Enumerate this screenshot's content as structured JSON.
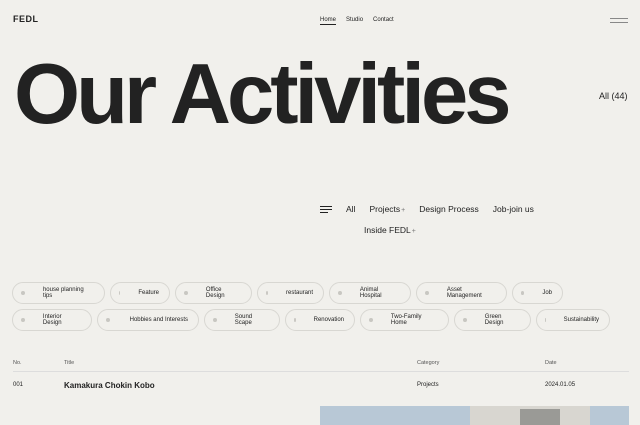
{
  "header": {
    "logo": "FEDL",
    "nav": [
      "Home",
      "Studio",
      "Contact"
    ]
  },
  "hero": {
    "title": "Our Activities",
    "total": "All (44)"
  },
  "filters": {
    "row1": [
      "All",
      "Projects",
      "Design Process",
      "Job-join us"
    ],
    "row2": [
      "Inside FEDL"
    ],
    "plus": "+"
  },
  "tags": {
    "row1": [
      "house planning tips",
      "Feature",
      "Office Design",
      "restaurant",
      "Animal Hospital",
      "Asset Management",
      "Job"
    ],
    "row2": [
      "Interior Design",
      "Hobbies and Interests",
      "Sound Scape",
      "Renovation",
      "Two-Family Home",
      "Green Design",
      "Sustainability"
    ]
  },
  "table": {
    "headers": {
      "no": "No.",
      "title": "Title",
      "category": "Category",
      "date": "Date"
    },
    "rows": [
      {
        "no": "001",
        "title": "Kamakura Chokin Kobo",
        "category": "Projects",
        "date": "2024.01.05"
      }
    ]
  }
}
